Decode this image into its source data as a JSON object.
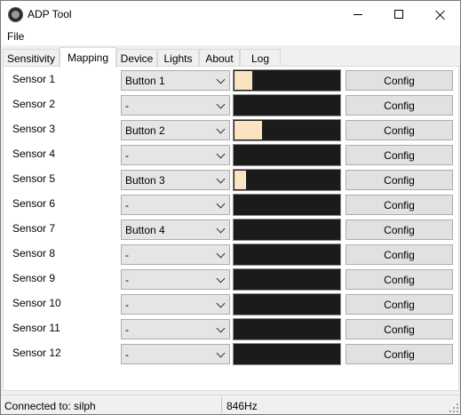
{
  "window": {
    "title": "ADP Tool",
    "icon": "app-icon"
  },
  "menu": {
    "file": "File"
  },
  "tabs": [
    {
      "label": "Sensitivity",
      "active": false
    },
    {
      "label": "Mapping",
      "active": true
    },
    {
      "label": "Device",
      "active": false
    },
    {
      "label": "Lights",
      "active": false
    },
    {
      "label": "About",
      "active": false
    },
    {
      "label": "Log",
      "active": false
    }
  ],
  "config_label": "Config",
  "sensors": [
    {
      "label": "Sensor 1",
      "mapping": "Button 1",
      "level": 0.17
    },
    {
      "label": "Sensor 2",
      "mapping": "-",
      "level": 0
    },
    {
      "label": "Sensor 3",
      "mapping": "Button 2",
      "level": 0.26
    },
    {
      "label": "Sensor 4",
      "mapping": "-",
      "level": 0
    },
    {
      "label": "Sensor 5",
      "mapping": "Button 3",
      "level": 0.11
    },
    {
      "label": "Sensor 6",
      "mapping": "-",
      "level": 0
    },
    {
      "label": "Sensor 7",
      "mapping": "Button 4",
      "level": 0
    },
    {
      "label": "Sensor 8",
      "mapping": "-",
      "level": 0
    },
    {
      "label": "Sensor 9",
      "mapping": "-",
      "level": 0
    },
    {
      "label": "Sensor 10",
      "mapping": "-",
      "level": 0
    },
    {
      "label": "Sensor 11",
      "mapping": "-",
      "level": 0
    },
    {
      "label": "Sensor 12",
      "mapping": "-",
      "level": 0
    }
  ],
  "status": {
    "connection": "Connected to: silph",
    "rate": "846Hz"
  },
  "colors": {
    "meter_bg": "#1b1b1b",
    "meter_fill": "#fae3c0"
  }
}
